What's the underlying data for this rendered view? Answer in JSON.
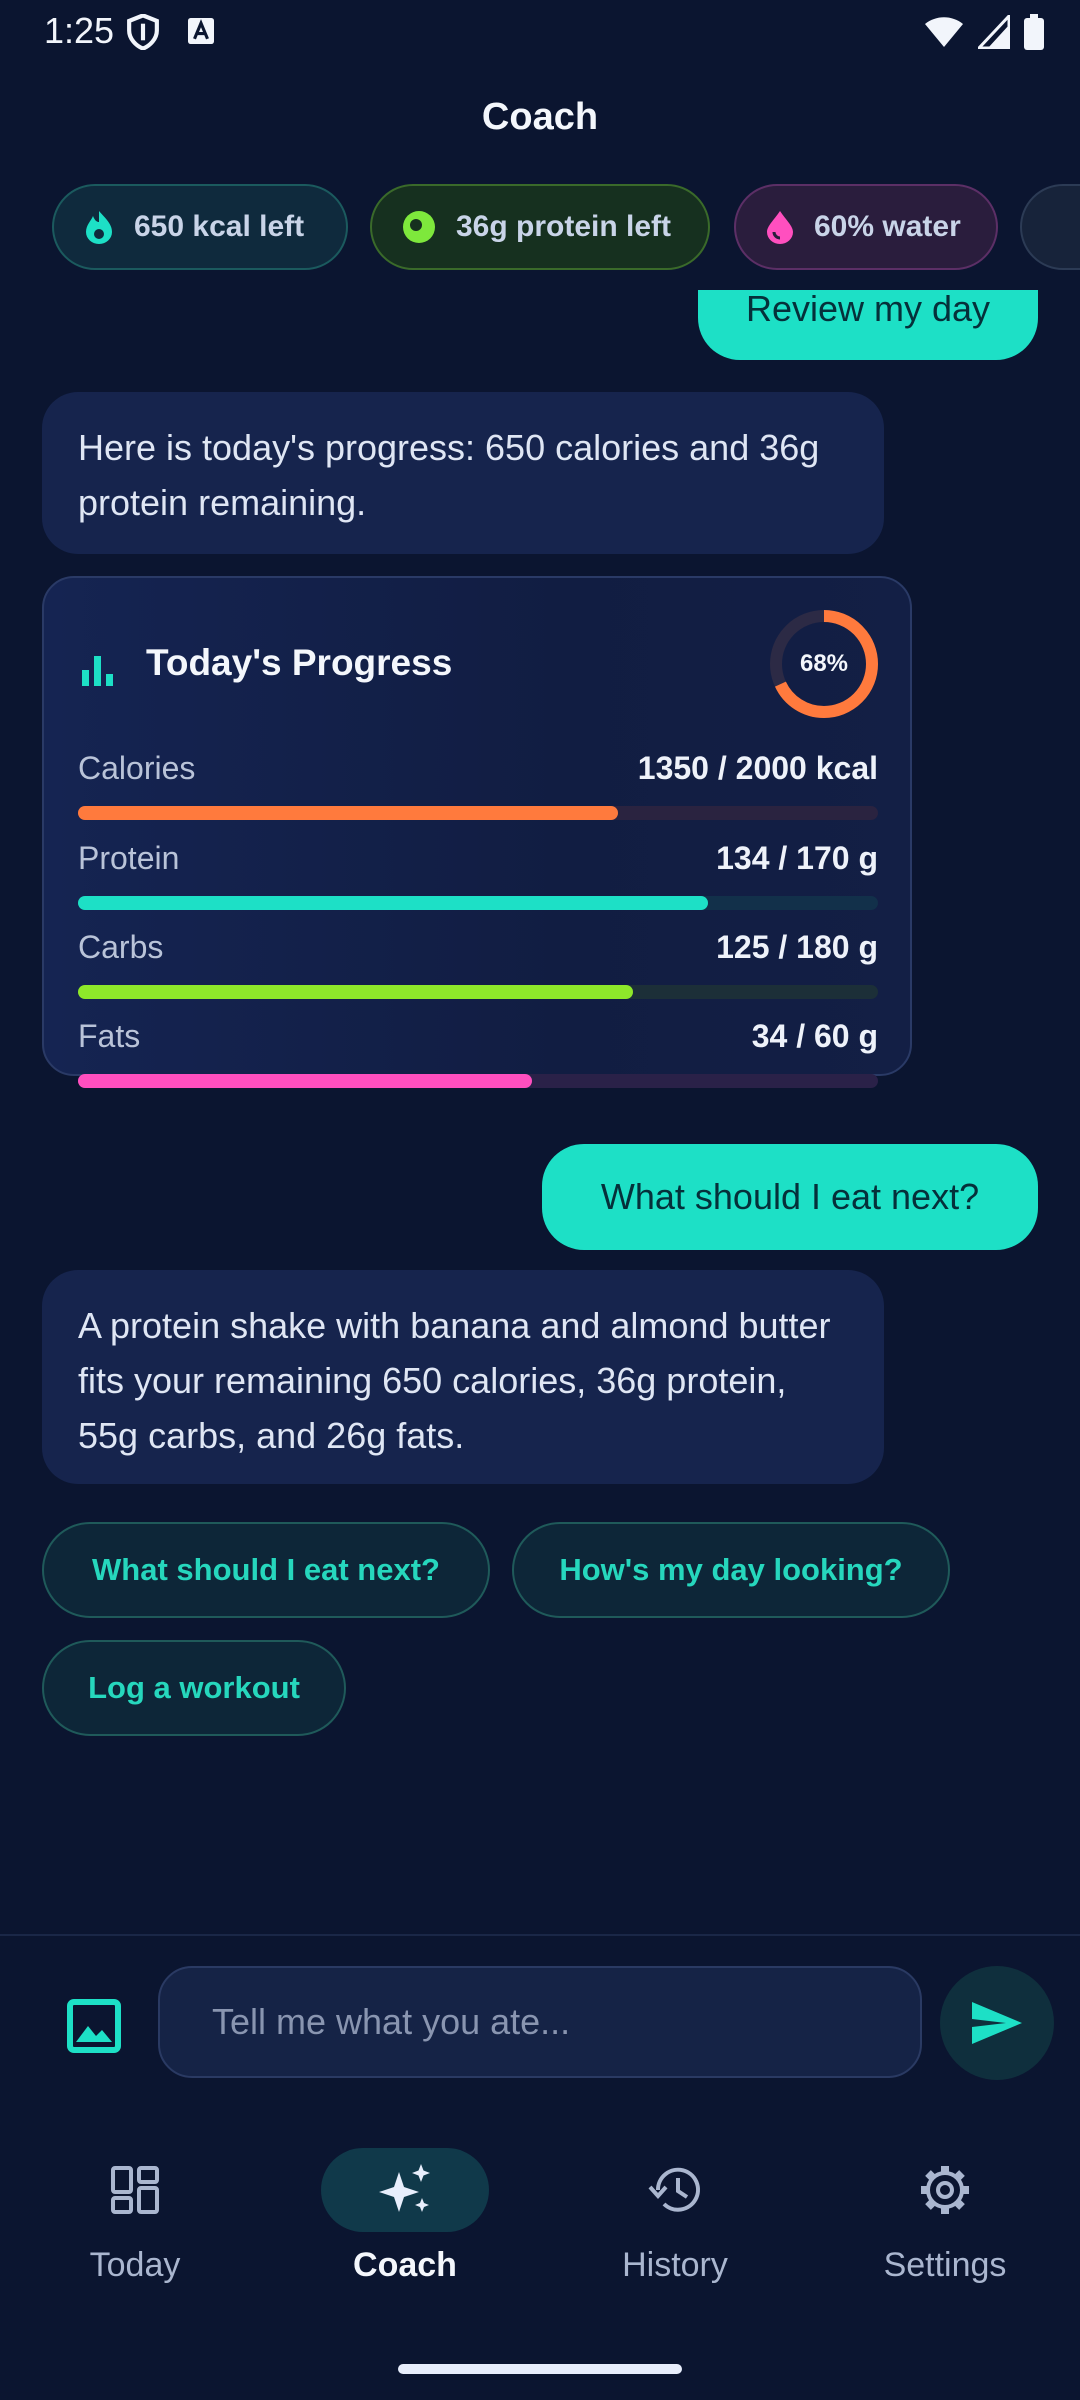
{
  "status_bar": {
    "time": "1:25",
    "icons": [
      "shield-icon",
      "a-badge-icon",
      "wifi-icon",
      "signal-icon",
      "battery-icon"
    ]
  },
  "header": {
    "title": "Coach"
  },
  "summary_chips": [
    {
      "label": "650 kcal left",
      "icon": "flame-icon",
      "color": "#1de0c6"
    },
    {
      "label": "36g protein left",
      "icon": "protein-icon",
      "color": "#7ee83c"
    },
    {
      "label": "60% water",
      "icon": "drop-icon",
      "color": "#ff4fbf"
    }
  ],
  "chat": {
    "messages": [
      {
        "role": "user",
        "text": "Review my day"
      },
      {
        "role": "assistant",
        "text": "Here is today's progress: 650 calories and 36g protein remaining."
      },
      {
        "role": "user",
        "text": "What should I eat next?"
      },
      {
        "role": "assistant",
        "text": "A protein shake with banana and almond butter fits your remaining 650 calories, 36g protein, 55g carbs, and 26g fats."
      }
    ],
    "progress_card": {
      "title": "Today's Progress",
      "ring_label": "68%",
      "ring_fraction": 0.68,
      "ring_color": "#ff7a3d",
      "macros": [
        {
          "label": "Calories",
          "value": "1350 / 2000 kcal",
          "fraction": 0.675,
          "color": "#ff7a3d",
          "track": "#2a2340"
        },
        {
          "label": "Protein",
          "value": "134 / 170 g",
          "fraction": 0.788,
          "color": "#1de0c6",
          "track": "#12304a"
        },
        {
          "label": "Carbs",
          "value": "125 / 180 g",
          "fraction": 0.694,
          "color": "#8ee82a",
          "track": "#1c2f38"
        },
        {
          "label": "Fats",
          "value": "34 / 60 g",
          "fraction": 0.567,
          "color": "#ff4fbf",
          "track": "#2a2148"
        }
      ]
    },
    "suggestions": [
      "What should I eat next?",
      "How's my day looking?",
      "Log a workout"
    ]
  },
  "composer": {
    "placeholder": "Tell me what you ate...",
    "image_icon": "image-icon",
    "send_icon": "send-icon"
  },
  "nav": {
    "items": [
      {
        "label": "Today",
        "icon": "dashboard-icon"
      },
      {
        "label": "Coach",
        "icon": "sparkle-icon",
        "active": true
      },
      {
        "label": "History",
        "icon": "history-icon"
      },
      {
        "label": "Settings",
        "icon": "gear-icon"
      }
    ]
  },
  "colors": {
    "accent": "#1de0c6",
    "background": "#0b1530",
    "bubble": "#16244d"
  }
}
